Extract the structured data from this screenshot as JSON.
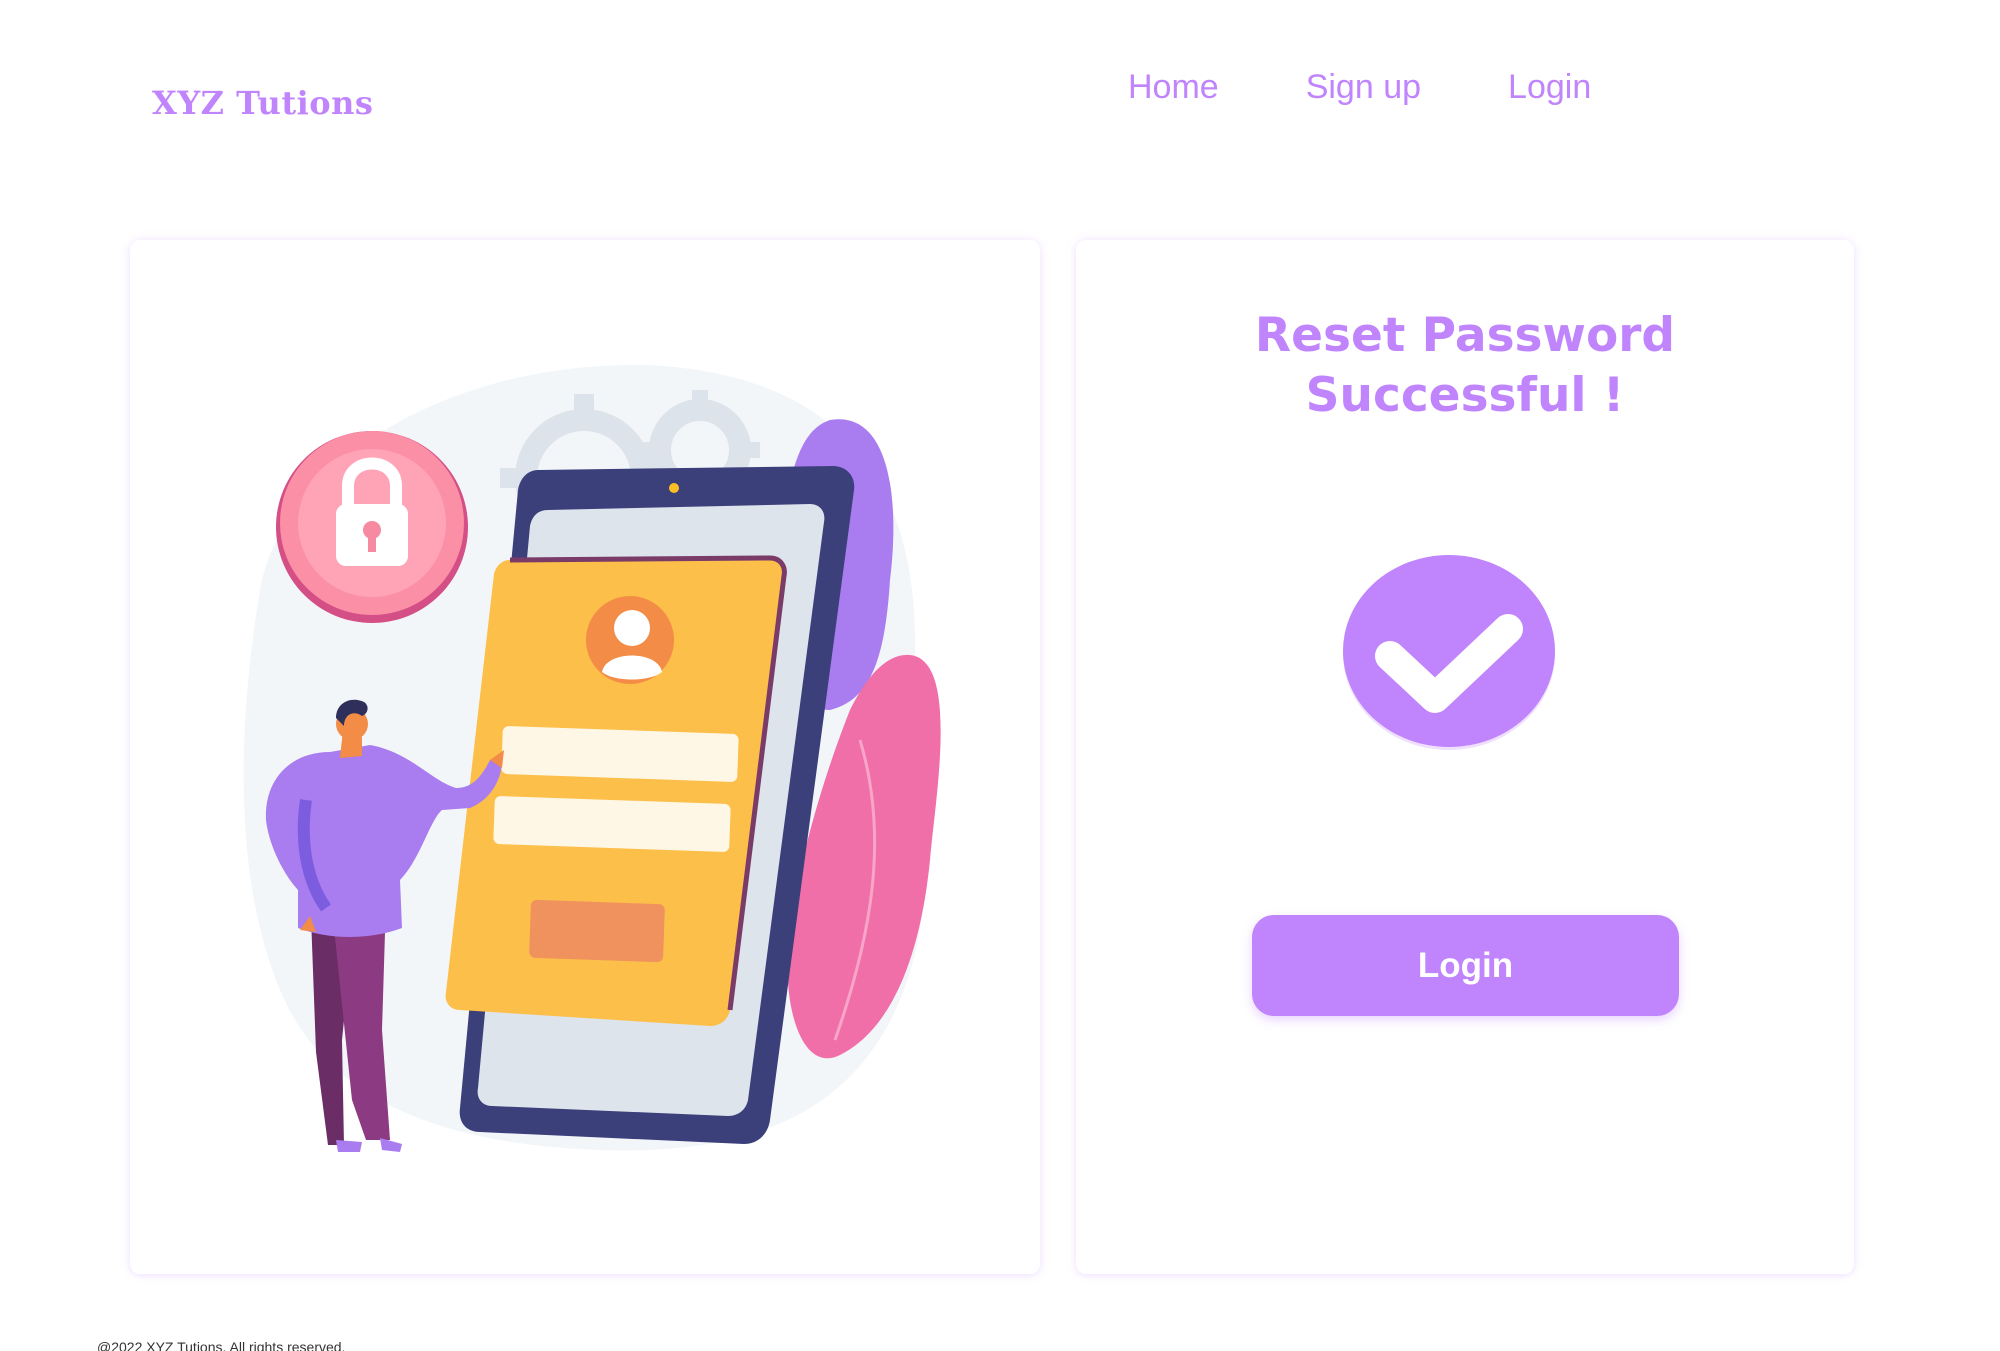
{
  "header": {
    "brand": "XYZ Tutions",
    "nav": [
      {
        "label": "Home"
      },
      {
        "label": "Sign up"
      },
      {
        "label": "Login"
      }
    ]
  },
  "reset_card": {
    "title_line1": "Reset Password",
    "title_line2": "Successful !",
    "login_button": "Login"
  },
  "footer": {
    "text": "@2022 XYZ Tutions. All rights reserved."
  },
  "icons": {
    "success": "check-icon",
    "illustration": "mobile-login-security-illustration"
  },
  "colors": {
    "accent": "#c084fc",
    "phone_card": "#fbbf24",
    "lock_badge": "#f472b6"
  }
}
